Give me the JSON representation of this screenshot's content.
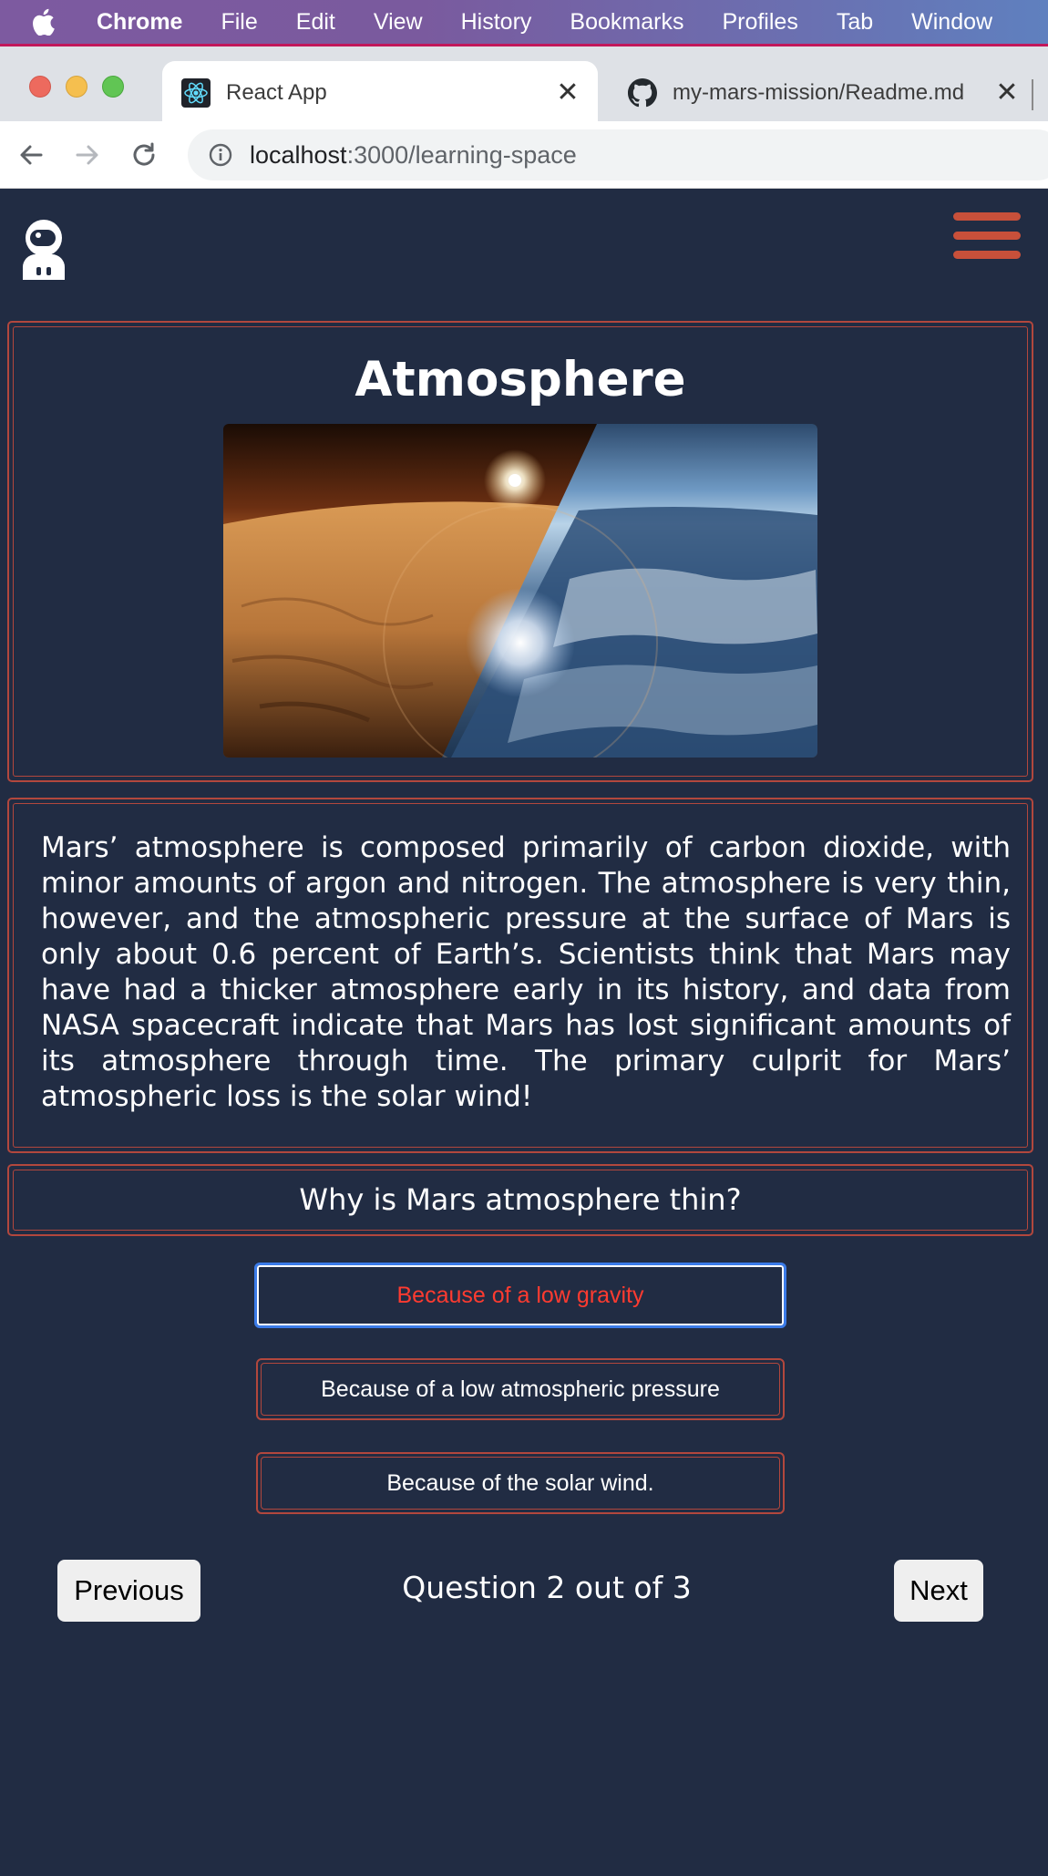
{
  "menubar": {
    "apple_icon": "apple-icon",
    "items": [
      "Chrome",
      "File",
      "Edit",
      "View",
      "History",
      "Bookmarks",
      "Profiles",
      "Tab",
      "Window"
    ]
  },
  "tabs": [
    {
      "title": "React App",
      "icon": "react-icon",
      "active": true
    },
    {
      "title": "my-mars-mission/Readme.md",
      "icon": "github-icon",
      "active": false
    }
  ],
  "address_bar": {
    "host": "localhost",
    "rest": ":3000/learning-space"
  },
  "header": {
    "logo_icon": "astronaut-icon",
    "menu_icon": "hamburger-icon"
  },
  "hero": {
    "title": "Atmosphere",
    "image": "mars-vs-earth-atmosphere-image"
  },
  "content": {
    "paragraph": "Mars’ atmosphere is composed primarily of carbon dioxide, with minor amounts of argon and nitrogen. The atmosphere is very thin, however, and the atmospheric pressure at the surface of Mars is only about 0.6 percent of Earth’s. Scientists think that Mars may have had a thicker atmosphere early in its history, and data from NASA spacecraft indicate that Mars has lost significant amounts of its atmosphere through time. The primary culprit for Mars’ atmospheric loss is the solar wind!"
  },
  "quiz": {
    "question": "Why is Mars atmosphere thin?",
    "answers": [
      "Because of a low gravity",
      "Because of a low atmospheric pressure",
      "Because of the solar wind."
    ],
    "selected_index": 0,
    "counter": "Question 2 out of 3",
    "prev_label": "Previous",
    "next_label": "Next"
  },
  "colors": {
    "page_bg": "#212c43",
    "accent_border": "#b2473d",
    "selected_text": "#ff3b30",
    "focus_ring": "#3b7be8",
    "hamburger": "#c8503a"
  }
}
